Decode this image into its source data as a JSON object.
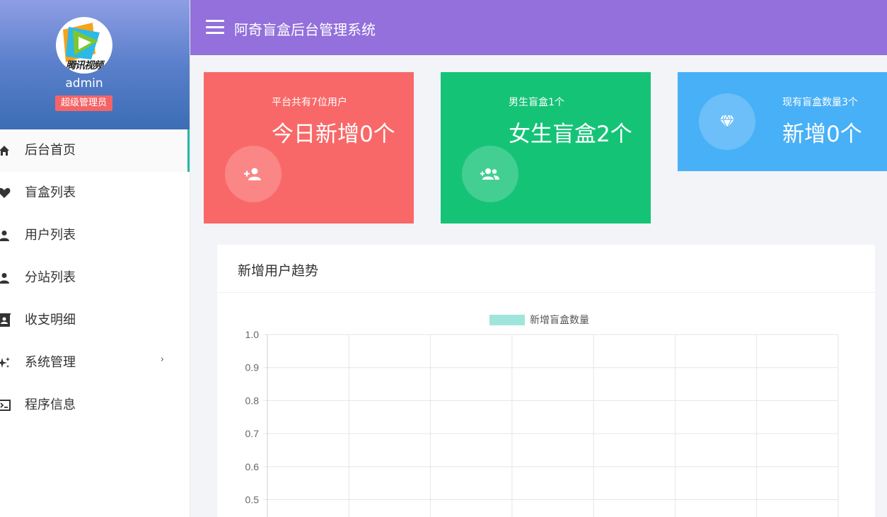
{
  "sidebar": {
    "avatar_logo_text": "腾讯视频",
    "username": "admin",
    "role": "超级管理员",
    "items": [
      {
        "label": "后台首页",
        "icon": "home-icon",
        "active": true
      },
      {
        "label": "盲盒列表",
        "icon": "heart-icon"
      },
      {
        "label": "用户列表",
        "icon": "user-icon"
      },
      {
        "label": "分站列表",
        "icon": "user-icon"
      },
      {
        "label": "收支明细",
        "icon": "contact-card-icon"
      },
      {
        "label": "系统管理",
        "icon": "sparkle-icon",
        "has_submenu": true,
        "chevron": "›"
      },
      {
        "label": "程序信息",
        "icon": "terminal-icon"
      }
    ]
  },
  "header": {
    "title": "阿奇盲盒后台管理系统",
    "color": "#9370db"
  },
  "cards": [
    {
      "subtitle": "平台共有7位用户",
      "title": "今日新增0个",
      "icon": "add-user-icon",
      "color": "#f96868"
    },
    {
      "subtitle": "男生盲盒1个",
      "title": "女生盲盒2个",
      "icon": "group-icon",
      "color": "#15c377"
    },
    {
      "subtitle": "现有盲盒数量3个",
      "title": "新增0个",
      "icon": "diamond-icon",
      "color": "#48b0f7"
    }
  ],
  "panel": {
    "title": "新增用户趋势"
  },
  "chart_data": {
    "type": "line",
    "series": [
      {
        "name": "新增盲盒数量",
        "values": [],
        "color": "#9fe5dd"
      }
    ],
    "ylim": [
      0.5,
      1.0
    ],
    "yticks": [
      "1.0",
      "0.9",
      "0.8",
      "0.7",
      "0.6",
      "0.5"
    ],
    "grid": true,
    "legend_position": "top-center"
  }
}
